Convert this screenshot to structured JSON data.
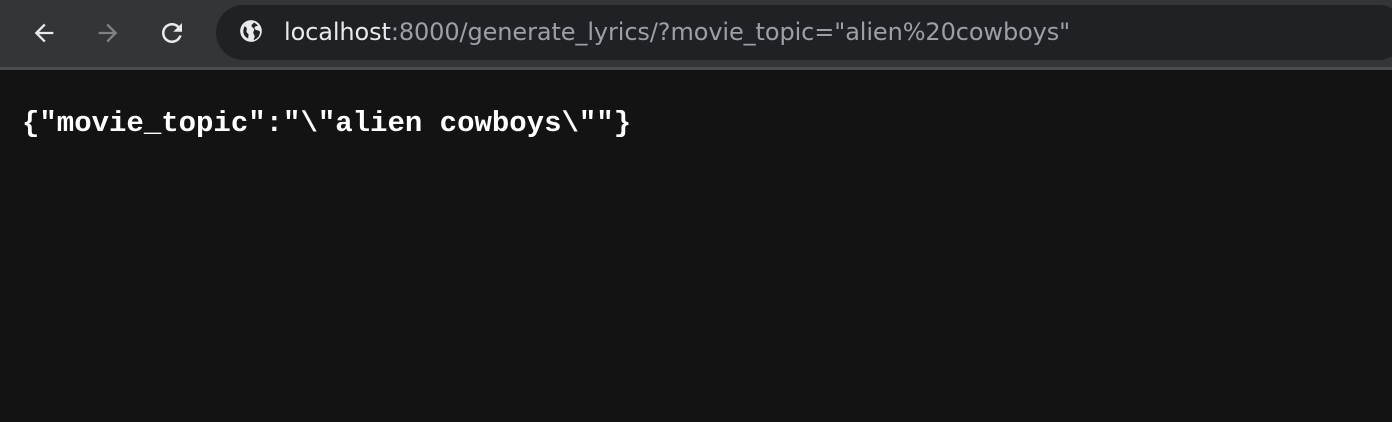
{
  "toolbar": {
    "back_icon": "arrow-left-icon",
    "forward_icon": "arrow-right-icon",
    "reload_icon": "reload-icon",
    "site_info_icon": "globe-icon"
  },
  "address_bar": {
    "host": "localhost",
    "rest": ":8000/generate_lyrics/?movie_topic=\"alien%20cowboys\""
  },
  "page": {
    "body_text": "{\"movie_topic\":\"\\\"alien cowboys\\\"\"}"
  },
  "colors": {
    "toolbar_bg": "#343538",
    "omnibox_bg": "#202124",
    "page_bg": "#131313",
    "url_host": "#e8eaed",
    "url_rest": "#9aa0a6",
    "forward_disabled": "#7f8184"
  }
}
